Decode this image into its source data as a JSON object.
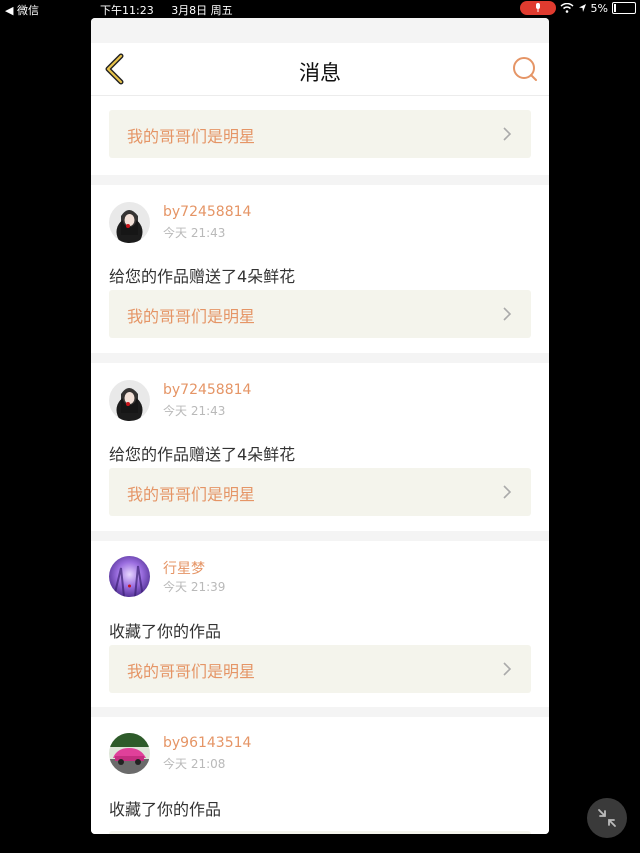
{
  "status_bar": {
    "back_app": "◀ 微信",
    "time": "下午11:23",
    "date": "3月8日 周五",
    "battery": "5%"
  },
  "header": {
    "title": "消息"
  },
  "colors": {
    "accent": "#e59566",
    "card_bg": "#f4f4ec",
    "time_gray": "#b9b9b9"
  },
  "partial_top": {
    "work_title": "我的哥哥们是明星"
  },
  "messages": [
    {
      "user": "by72458814",
      "time": "今天 21:43",
      "text": "给您的作品赠送了4朵鲜花",
      "work_title": "我的哥哥们是明星"
    },
    {
      "user": "by72458814",
      "time": "今天 21:43",
      "text": "给您的作品赠送了4朵鲜花",
      "work_title": "我的哥哥们是明星"
    },
    {
      "user": "行星梦",
      "time": "今天 21:39",
      "text": "收藏了你的作品",
      "work_title": "我的哥哥们是明星"
    },
    {
      "user": "by96143514",
      "time": "今天 21:08",
      "text": "收藏了你的作品"
    }
  ]
}
